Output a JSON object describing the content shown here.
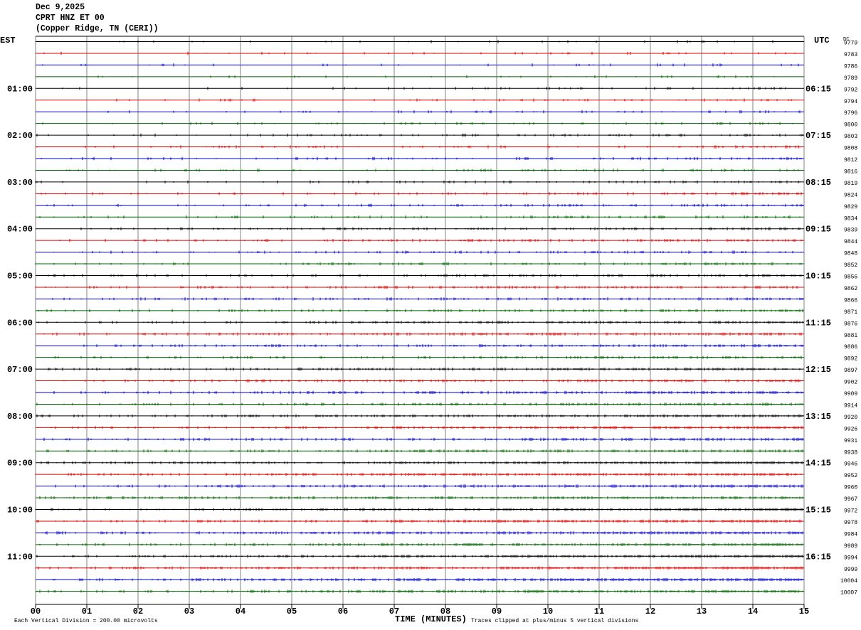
{
  "header": {
    "date": "Dec 9,2025",
    "station": "CPRT HNZ ET 00",
    "location": "(Copper Ridge, TN (CERI))"
  },
  "left_tz": "EST",
  "right_tz": "UTC",
  "dc_label": "DC",
  "footer": {
    "scale_note": "Each Vertical Division =  200.00 microvolts",
    "xlabel": "TIME (MINUTES)",
    "clip_note": "Traces clipped at plus/minus 5 vertical divisions"
  },
  "colors": {
    "trace_cycle": [
      "#000000",
      "#dd0000",
      "#0000cc",
      "#006600"
    ],
    "grid": "#808080"
  },
  "chart_data": {
    "type": "helicorder",
    "title": "CPRT HNZ ET 00",
    "xlabel": "TIME (MINUTES)",
    "xlim": [
      0,
      15
    ],
    "x_ticks": [
      "00",
      "01",
      "02",
      "03",
      "04",
      "05",
      "06",
      "07",
      "08",
      "09",
      "10",
      "11",
      "12",
      "13",
      "14",
      "15"
    ],
    "left_hour_labels": [
      "01:00",
      "02:00",
      "03:00",
      "04:00",
      "05:00",
      "06:00",
      "07:00",
      "08:00",
      "09:00",
      "10:00",
      "11:00"
    ],
    "right_hour_labels": [
      "06:15",
      "07:15",
      "08:15",
      "09:15",
      "10:15",
      "11:15",
      "12:15",
      "13:15",
      "14:15",
      "15:15",
      "16:15"
    ],
    "dc_offsets": [
      "9779",
      "9783",
      "9786",
      "9789",
      "9792",
      "9794",
      "9796",
      "9800",
      "9803",
      "9808",
      "9812",
      "9816",
      "9819",
      "9824",
      "9829",
      "9834",
      "9839",
      "9844",
      "9848",
      "9852",
      "9856",
      "9862",
      "9866",
      "9871",
      "9876",
      "9881",
      "9886",
      "9892",
      "9897",
      "9902",
      "9909",
      "9914",
      "9920",
      "9926",
      "9931",
      "9938",
      "9946",
      "9952",
      "9960",
      "9967",
      "9972",
      "9978",
      "9984",
      "9989",
      "9994",
      "9999",
      "10004",
      "10007"
    ]
  }
}
